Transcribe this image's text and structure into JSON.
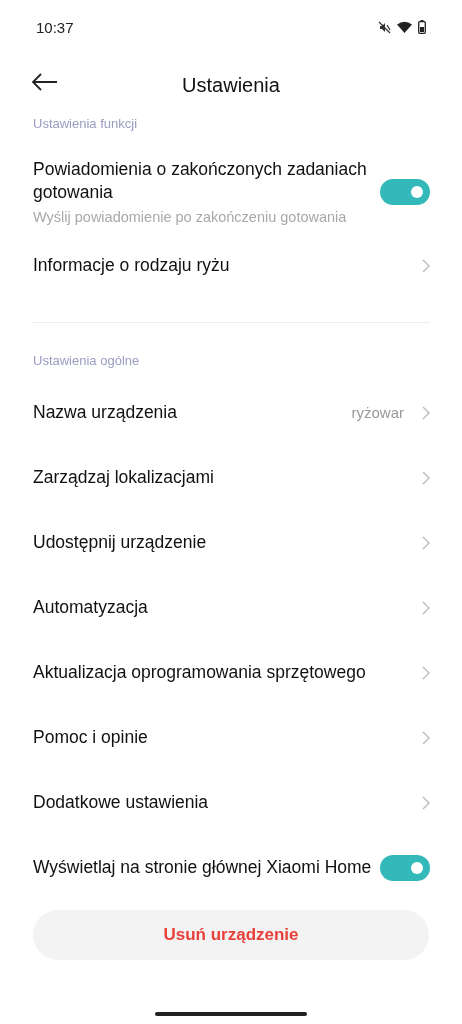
{
  "status_bar": {
    "time": "10:37"
  },
  "header": {
    "title": "Ustawienia"
  },
  "sections": [
    {
      "label": "Ustawienia funkcji",
      "items": [
        {
          "kind": "toggle",
          "title": "Powiadomienia o zakończonych zadaniach gotowania",
          "subtitle": "Wyślij powiadomienie po zakończeniu gotowania",
          "on": true
        },
        {
          "kind": "link",
          "title": "Informacje o rodzaju ryżu"
        }
      ]
    },
    {
      "label": "Ustawienia ogólne",
      "items": [
        {
          "kind": "link",
          "title": "Nazwa urządzenia",
          "value": "ryżowar"
        },
        {
          "kind": "link",
          "title": "Zarządzaj lokalizacjami"
        },
        {
          "kind": "link",
          "title": "Udostępnij urządzenie"
        },
        {
          "kind": "link",
          "title": "Automatyzacja"
        },
        {
          "kind": "link",
          "title": "Aktualizacja oprogramowania sprzętowego"
        },
        {
          "kind": "link",
          "title": "Pomoc i opinie"
        },
        {
          "kind": "link",
          "title": "Dodatkowe ustawienia"
        },
        {
          "kind": "toggle",
          "title": "Wyświetlaj na stronie głównej Xiaomi Home",
          "on": true
        }
      ]
    }
  ],
  "delete_button": "Usuń urządzenie"
}
